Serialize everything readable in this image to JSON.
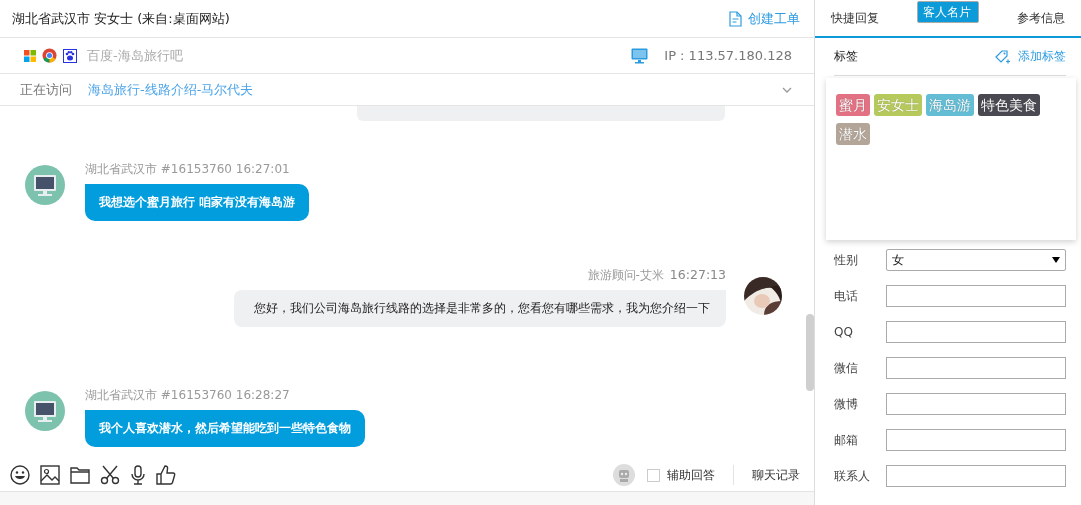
{
  "header": {
    "title": "湖北省武汉市 安女士 (来自:桌面网站)",
    "action": "创建工单"
  },
  "source": {
    "site": "百度-海岛旅行吧",
    "ip": "IP : 113.57.180.128"
  },
  "visiting": {
    "label": "正在访问",
    "page": "海岛旅行-线路介绍-马尔代夫"
  },
  "messages": [
    {
      "kind": "visitor",
      "meta": "湖北省武汉市 #16153760 16:27:01",
      "text": "我想选个蜜月旅行 咱家有没有海岛游"
    },
    {
      "kind": "agent",
      "name": "旅游顾问-艾米",
      "time": "16:27:13",
      "text": "您好，我们公司海岛旅行线路的选择是非常多的，您看您有哪些需求，我为您介绍一下"
    },
    {
      "kind": "visitor",
      "meta": "湖北省武汉市 #16153760 16:28:27",
      "text": "我个人喜欢潜水，然后希望能吃到一些特色食物"
    }
  ],
  "toolbar": {
    "assist": {
      "label": "辅助回答",
      "checked": false
    },
    "history": "聊天记录"
  },
  "tabs": [
    {
      "label": "快捷回复",
      "selected": false
    },
    {
      "label": "客人名片",
      "selected": true
    },
    {
      "label": "参考信息",
      "selected": false
    }
  ],
  "tags": {
    "title": "标签",
    "add": "添加标签",
    "items": [
      {
        "label": "蜜月",
        "color": "#e27283"
      },
      {
        "label": "安女士",
        "color": "#b6c95c"
      },
      {
        "label": "海岛游",
        "color": "#63bdd5"
      },
      {
        "label": "特色美食",
        "color": "#4a4952"
      },
      {
        "label": "潜水",
        "color": "#b3a598"
      }
    ]
  },
  "fields": [
    {
      "kind": "select",
      "label": "性别",
      "value": "女"
    },
    {
      "kind": "input",
      "label": "电话"
    },
    {
      "kind": "input",
      "label": "QQ"
    },
    {
      "kind": "input",
      "label": "微信"
    },
    {
      "kind": "input",
      "label": "微博"
    },
    {
      "kind": "input",
      "label": "邮箱"
    },
    {
      "kind": "input",
      "label": "联系人"
    }
  ]
}
